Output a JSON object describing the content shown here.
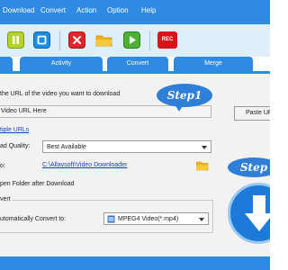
{
  "menu": {
    "items": [
      {
        "label": "Download"
      },
      {
        "label": "Convert"
      },
      {
        "label": "Action"
      },
      {
        "label": "Option"
      },
      {
        "label": "Help"
      }
    ]
  },
  "toolbar": {
    "rec_label": "REC"
  },
  "tabs": [
    {
      "label": "Activity"
    },
    {
      "label": "Convert"
    },
    {
      "label": "Merge"
    }
  ],
  "download": {
    "instruction": "the URL of the video you want to download",
    "url_value": "Video URL Here",
    "paste_label": "Paste URL",
    "multiple_urls_link": "tiple URLs",
    "quality_label": "ad Quality:",
    "quality_value": "Best Available",
    "save_to_label": "o:",
    "save_path": "C:\\Allavsoft\\Video Downloader",
    "open_folder_label": "pen Folder after Download",
    "convert_group_label": "vert",
    "auto_convert_label": "utomatically Convert to:",
    "convert_format": "MPEG4 Video(*.mp4)"
  },
  "steps": {
    "step1": "Step1",
    "step2": "Step"
  },
  "colors": {
    "primary_blue": "#2f8ae3",
    "toolbar_bg": "#dfeefb",
    "rec_red": "#d8141a",
    "link_blue": "#1a3fb8"
  },
  "icons": {
    "pause": "pause-icon",
    "stop": "stop-icon",
    "delete": "delete-icon",
    "folder": "folder-icon",
    "play": "play-icon",
    "download_arrow": "download-arrow-icon"
  }
}
